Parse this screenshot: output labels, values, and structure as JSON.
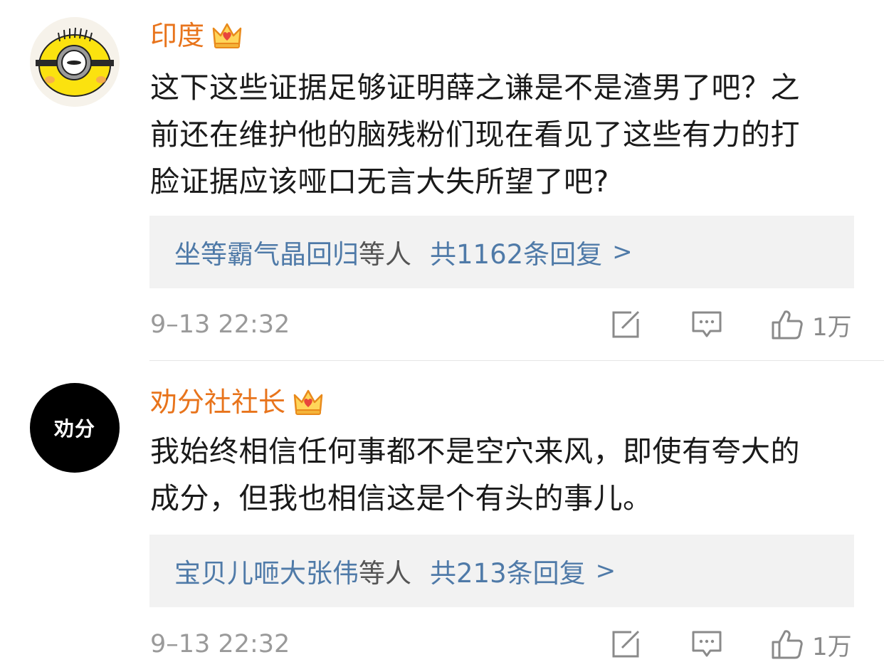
{
  "comments": [
    {
      "username": "印度",
      "avatar_icon": "minion-icon",
      "badge_icon": "crown-icon",
      "text": "这下这些证据足够证明薛之谦是不是渣男了吧？之前还在维护他的脑残粉们现在看见了这些有力的打脸证据应该哑口无言大失所望了吧?",
      "lines": [
        "这下这些证据足够证明薛之谦是不是渣男了吧？之",
        "前还在维护他的脑残粉们现在看见了这些有力的打",
        "脸证据应该哑口无言大失所望了吧?"
      ],
      "replies": {
        "names": "坐等霸气晶回归",
        "suffix": "等人",
        "count": "共1162条回复",
        "arrow": ">"
      },
      "timestamp": "9–13 22:32",
      "likes": "1万"
    },
    {
      "username": "劝分社社长",
      "avatar_text": "劝分",
      "badge_icon": "crown-icon",
      "lines": [
        "我始终相信任何事都不是空穴来风，即使有夸大的",
        "成分，但我也相信这是个有头的事儿。"
      ],
      "replies": {
        "names": "宝贝儿咂大张伟",
        "suffix": "等人",
        "count": "共213条回复",
        "arrow": ">"
      },
      "timestamp": "9–13 22:32",
      "likes": "1万"
    }
  ],
  "colors": {
    "username": "#e8741c",
    "link": "#4f7aa8",
    "reply_bg": "#f2f2f2",
    "meta": "#9a9a9a"
  }
}
